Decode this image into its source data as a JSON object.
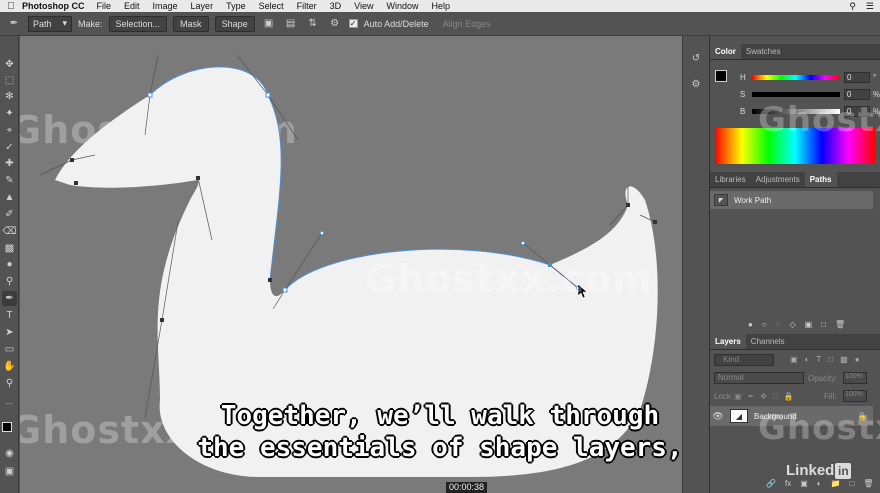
{
  "menubar": {
    "app_name": "Photoshop CC",
    "menus": [
      "File",
      "Edit",
      "Image",
      "Layer",
      "Type",
      "Select",
      "Filter",
      "3D",
      "View",
      "Window",
      "Help"
    ]
  },
  "options_bar": {
    "mode_value": "Path",
    "make_label": "Make:",
    "selection_button": "Selection...",
    "mask_button": "Mask",
    "shape_button": "Shape",
    "auto_add_delete_label": "Auto Add/Delete",
    "auto_add_delete_checked": true,
    "align_edges_label": "Align Edges"
  },
  "color_panel": {
    "tabs": [
      "Color",
      "Swatches"
    ],
    "active_tab": "Color",
    "sliders": [
      {
        "label": "H",
        "value": "0",
        "unit": "°"
      },
      {
        "label": "S",
        "value": "0",
        "unit": "%"
      },
      {
        "label": "B",
        "value": "0",
        "unit": "%"
      }
    ]
  },
  "paths_panel": {
    "tabs": [
      "Libraries",
      "Adjustments",
      "Paths"
    ],
    "active_tab": "Paths",
    "paths": [
      {
        "name": "Work Path"
      }
    ]
  },
  "layers_panel": {
    "tabs": [
      "Layers",
      "Channels"
    ],
    "active_tab": "Layers",
    "filter_placeholder": "Kind",
    "blend_mode": "Normal",
    "opacity_label": "Opacity:",
    "opacity_value": "100%",
    "lock_label": "Lock:",
    "fill_label": "Fill:",
    "fill_value": "100%",
    "layers": [
      {
        "name": "Background",
        "locked": true
      }
    ]
  },
  "subtitles": {
    "line1": "Together, we’ll walk through",
    "line2": "the essentials of shape layers,"
  },
  "video": {
    "timestamp": "00:00:38",
    "watermark": "Ghostxx.com",
    "brand": "Linked"
  },
  "colors": {
    "path_stroke": "#4a8fd6",
    "shape_fill": "#f1f1f1",
    "canvas_bg": "#7a7a7a"
  }
}
